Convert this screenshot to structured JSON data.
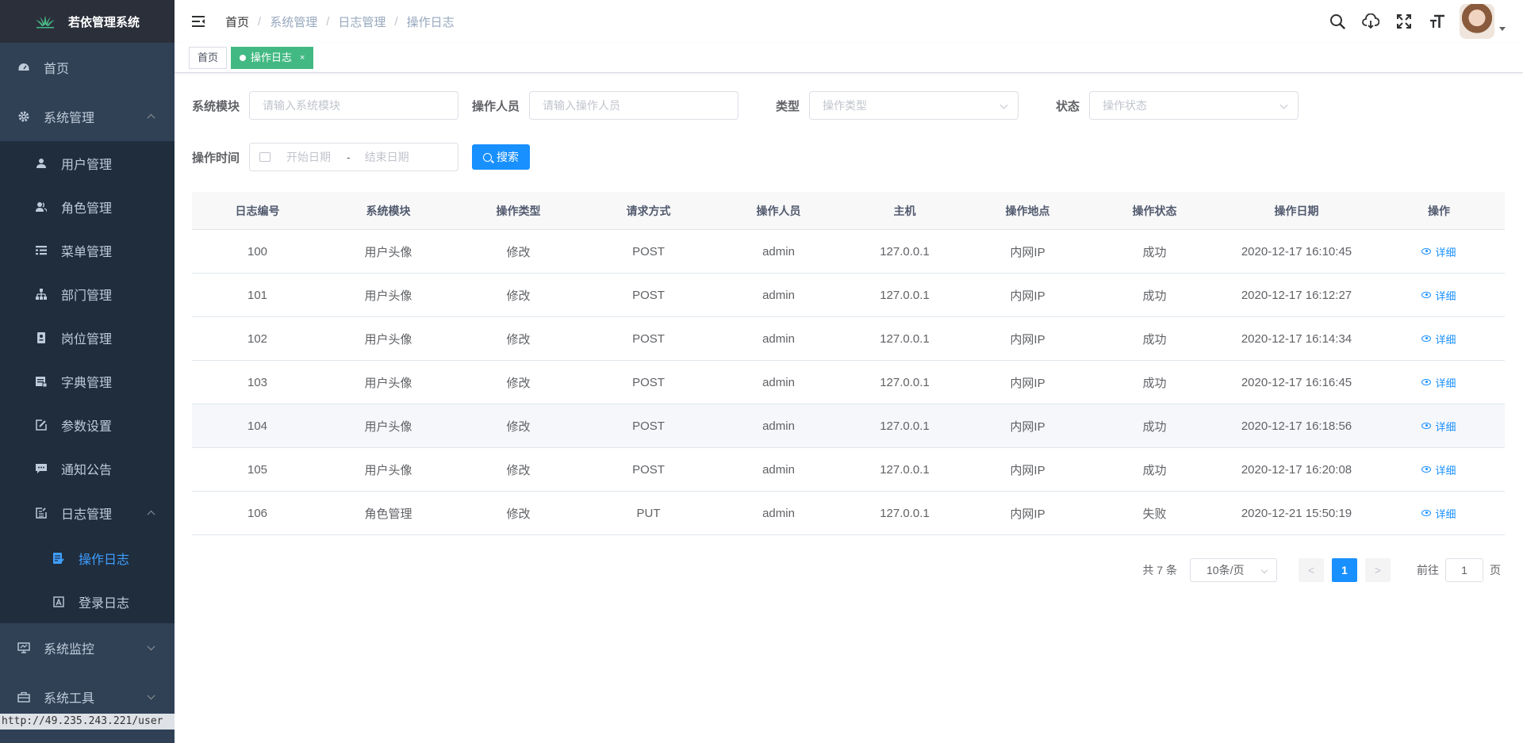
{
  "app": {
    "title": "若依管理系统"
  },
  "sidebar": {
    "items": [
      {
        "label": "首页",
        "icon": "dashboard-icon"
      },
      {
        "label": "系统管理",
        "icon": "gear-icon",
        "expanded": true,
        "children": [
          {
            "label": "用户管理",
            "icon": "user-icon"
          },
          {
            "label": "角色管理",
            "icon": "peoples-icon"
          },
          {
            "label": "菜单管理",
            "icon": "tree-table-icon"
          },
          {
            "label": "部门管理",
            "icon": "tree-icon"
          },
          {
            "label": "岗位管理",
            "icon": "post-icon"
          },
          {
            "label": "字典管理",
            "icon": "dict-icon"
          },
          {
            "label": "参数设置",
            "icon": "edit-icon"
          },
          {
            "label": "通知公告",
            "icon": "message-icon"
          },
          {
            "label": "日志管理",
            "icon": "log-icon",
            "expanded": true,
            "children": [
              {
                "label": "操作日志",
                "icon": "form-icon",
                "active": true
              },
              {
                "label": "登录日志",
                "icon": "logininfor-icon"
              }
            ]
          }
        ]
      },
      {
        "label": "系统监控",
        "icon": "monitor-icon"
      },
      {
        "label": "系统工具",
        "icon": "tool-icon"
      }
    ],
    "status_url": "http://49.235.243.221/user"
  },
  "breadcrumb": [
    "首页",
    "系统管理",
    "日志管理",
    "操作日志"
  ],
  "tags": [
    {
      "label": "首页",
      "active": false
    },
    {
      "label": "操作日志",
      "active": true,
      "close": "×"
    }
  ],
  "search": {
    "module_label": "系统模块",
    "module_placeholder": "请输入系统模块",
    "operator_label": "操作人员",
    "operator_placeholder": "请输入操作人员",
    "type_label": "类型",
    "type_placeholder": "操作类型",
    "status_label": "状态",
    "status_placeholder": "操作状态",
    "time_label": "操作时间",
    "start_placeholder": "开始日期",
    "range_sep": "-",
    "end_placeholder": "结束日期",
    "search_button": "搜索"
  },
  "table": {
    "columns": [
      "日志编号",
      "系统模块",
      "操作类型",
      "请求方式",
      "操作人员",
      "主机",
      "操作地点",
      "操作状态",
      "操作日期",
      "操作"
    ],
    "rows": [
      [
        "100",
        "用户头像",
        "修改",
        "POST",
        "admin",
        "127.0.0.1",
        "内网IP",
        "成功",
        "2020-12-17 16:10:45",
        "详细"
      ],
      [
        "101",
        "用户头像",
        "修改",
        "POST",
        "admin",
        "127.0.0.1",
        "内网IP",
        "成功",
        "2020-12-17 16:12:27",
        "详细"
      ],
      [
        "102",
        "用户头像",
        "修改",
        "POST",
        "admin",
        "127.0.0.1",
        "内网IP",
        "成功",
        "2020-12-17 16:14:34",
        "详细"
      ],
      [
        "103",
        "用户头像",
        "修改",
        "POST",
        "admin",
        "127.0.0.1",
        "内网IP",
        "成功",
        "2020-12-17 16:16:45",
        "详细"
      ],
      [
        "104",
        "用户头像",
        "修改",
        "POST",
        "admin",
        "127.0.0.1",
        "内网IP",
        "成功",
        "2020-12-17 16:18:56",
        "详细"
      ],
      [
        "105",
        "用户头像",
        "修改",
        "POST",
        "admin",
        "127.0.0.1",
        "内网IP",
        "成功",
        "2020-12-17 16:20:08",
        "详细"
      ],
      [
        "106",
        "角色管理",
        "修改",
        "PUT",
        "admin",
        "127.0.0.1",
        "内网IP",
        "失败",
        "2020-12-21 15:50:19",
        "详细"
      ]
    ]
  },
  "pagination": {
    "total_text": "共 7 条",
    "page_size": "10条/页",
    "prev": "<",
    "current_page": "1",
    "next": ">",
    "goto_label": "前往",
    "goto_value": "1",
    "page_suffix": "页"
  },
  "colors": {
    "sidebar_bg": "#304156",
    "accent": "#1890ff",
    "active_tag": "#42b983"
  }
}
